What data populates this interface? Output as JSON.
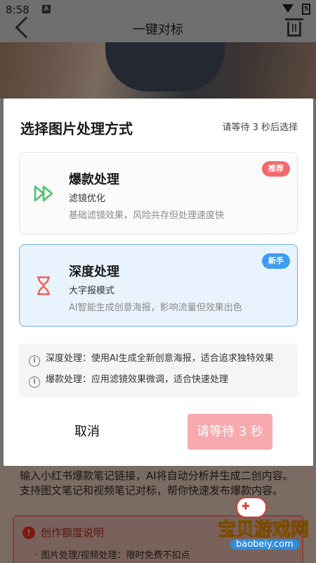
{
  "status": {
    "time": "8:58",
    "notif": "A",
    "battery": "5"
  },
  "header": {
    "title": "一键对标"
  },
  "modal": {
    "title": "选择图片处理方式",
    "wait_hint": "请等待 3 秒后选择",
    "options": [
      {
        "name": "爆款处理",
        "sub": "滤镜优化",
        "desc": "基础滤镜效果，风险共存但处理速度快",
        "badge": "推荐"
      },
      {
        "name": "深度处理",
        "sub": "大字报模式",
        "desc": "AI智能生成创意海报，影响流量但效果出色",
        "badge": "新手"
      }
    ],
    "info": [
      "深度处理：使用AI生成全新创意海报，适合追求独特效果",
      "爆款处理：应用滤镜效果微调，适合快速处理"
    ],
    "cancel_label": "取消",
    "confirm_label": "请等待 3 秒"
  },
  "background": {
    "desc_lines": [
      "输入小红书爆款笔记链接，AI将自动分析并生成二创内容。",
      "支持图文笔记和视频笔记对标，帮你快速发布爆款内容。"
    ],
    "quota_title": "创作额度说明",
    "quota_line": "· 图片处理/视频处理：限时免费不扣点"
  },
  "watermark": {
    "text": "宝贝游戏网",
    "url": "baobeiy.com"
  },
  "colors": {
    "badge_red": "#f26a6e",
    "badge_blue": "#3f9cf0",
    "confirm_disabled": "#f7a9ad",
    "selected_border": "#6aaeea"
  }
}
